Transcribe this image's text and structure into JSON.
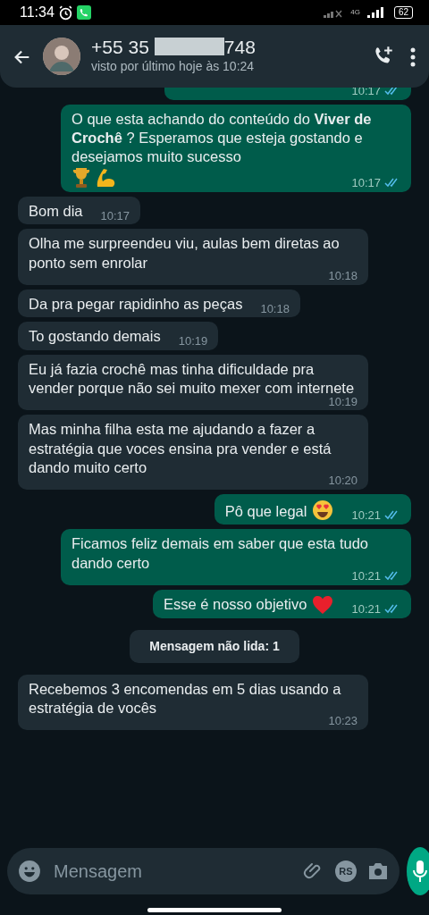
{
  "status_bar": {
    "time": "11:34",
    "battery": "62",
    "network": "4G"
  },
  "header": {
    "number_start": "+55 35",
    "number_end": "748",
    "subtitle": "visto por último hoje às 10:24"
  },
  "messages": [
    {
      "kind": "sent-cut",
      "time": "10:17",
      "read": true
    },
    {
      "kind": "sent",
      "text": "O que esta achando do conteúdo do **Viver de Crochê** ? Esperamos que esteja gostando e desejamos muito sucesso",
      "time": "10:17",
      "read": true,
      "emoji": [
        {
          "kind": "trophy"
        },
        {
          "kind": "muscle"
        }
      ]
    },
    {
      "kind": "received",
      "text": "Bom dia",
      "time": "10:17"
    },
    {
      "kind": "received",
      "text": "Olha me surpreendeu viu, aulas bem diretas ao ponto sem enrolar",
      "time": "10:18"
    },
    {
      "kind": "received",
      "text": "Da pra pegar rapidinho as peças",
      "time": "10:18"
    },
    {
      "kind": "received",
      "text": "To gostando demais",
      "time": "10:19"
    },
    {
      "kind": "received",
      "text": "Eu já fazia crochê mas tinha dificuldade pra vender porque não sei muito mexer com internete",
      "time": "10:19"
    },
    {
      "kind": "received",
      "text": "Mas minha filha esta me ajudando a fazer a estratégia que voces ensina pra vender e está dando muito certo",
      "time": "10:20"
    },
    {
      "kind": "sent",
      "text": "Pô que legal",
      "time": "10:21",
      "read": true,
      "emoji": [
        {
          "kind": "heart-eyes"
        }
      ]
    },
    {
      "kind": "sent",
      "text": "Ficamos feliz demais em saber que esta tudo dando certo",
      "time": "10:21",
      "read": true
    },
    {
      "kind": "sent",
      "text": "Esse é nosso objetivo",
      "time": "10:21",
      "read": true,
      "emoji": [
        {
          "kind": "heart"
        }
      ]
    },
    {
      "kind": "divider",
      "text": "Mensagem não lida: 1"
    },
    {
      "kind": "received",
      "text": "Recebemos 3 encomendas em 5 dias usando a estratégia de vocês",
      "time": "10:23"
    }
  ],
  "composer": {
    "placeholder": "Mensagem",
    "attachment_badge": "RS"
  }
}
